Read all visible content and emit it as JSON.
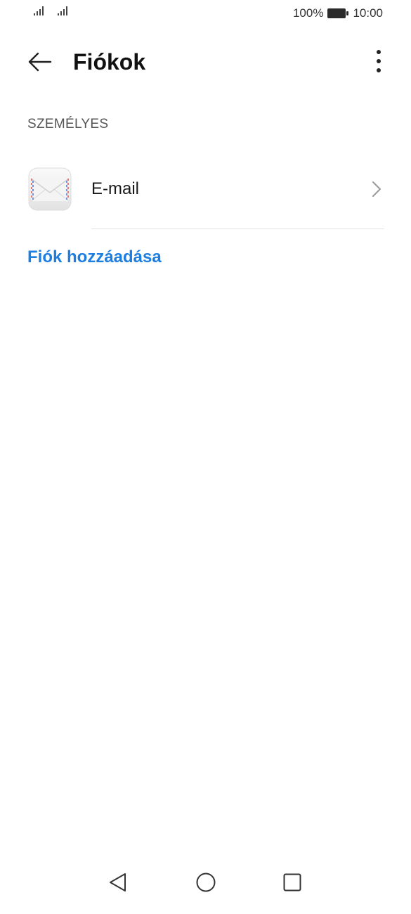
{
  "status_bar": {
    "battery_percent": "100%",
    "time": "10:00",
    "icons": [
      "signal-icon",
      "signal-icon",
      "battery-icon"
    ]
  },
  "app_bar": {
    "title": "Fiókok",
    "back_icon": "arrow-left-icon",
    "more_icon": "more-vertical-icon"
  },
  "section": {
    "header": "SZEMÉLYES",
    "accounts": [
      {
        "label": "E-mail",
        "icon": "email-envelope-icon",
        "chevron": "chevron-right-icon"
      }
    ]
  },
  "add_account_label": "Fiók hozzáadása",
  "nav_bar": {
    "icons": [
      "nav-back-icon",
      "nav-home-icon",
      "nav-recents-icon"
    ]
  },
  "colors": {
    "accent": "#1e7ee0",
    "background": "#ffffff",
    "divider": "#e3e3e3"
  }
}
